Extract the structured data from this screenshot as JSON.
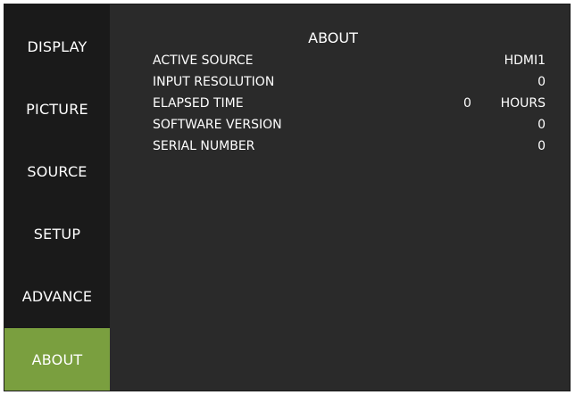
{
  "sidebar": {
    "items": [
      {
        "label": "DISPLAY"
      },
      {
        "label": "PICTURE"
      },
      {
        "label": "SOURCE"
      },
      {
        "label": "SETUP"
      },
      {
        "label": "ADVANCE"
      },
      {
        "label": "ABOUT",
        "active": true
      }
    ]
  },
  "panel": {
    "title": "ABOUT",
    "rows": [
      {
        "label": "ACTIVE SOURCE",
        "value": "HDMI1"
      },
      {
        "label": "INPUT RESOLUTION",
        "value": "0"
      },
      {
        "label": "ELAPSED TIME",
        "number": "0",
        "value": "HOURS"
      },
      {
        "label": "SOFTWARE VERSION",
        "value": "0"
      },
      {
        "label": "SERIAL NUMBER",
        "value": "0"
      }
    ]
  },
  "colors": {
    "background": "#2a2a2a",
    "sidebar": "#1a1a1a",
    "active": "#7a9f3f",
    "text": "#ffffff"
  }
}
